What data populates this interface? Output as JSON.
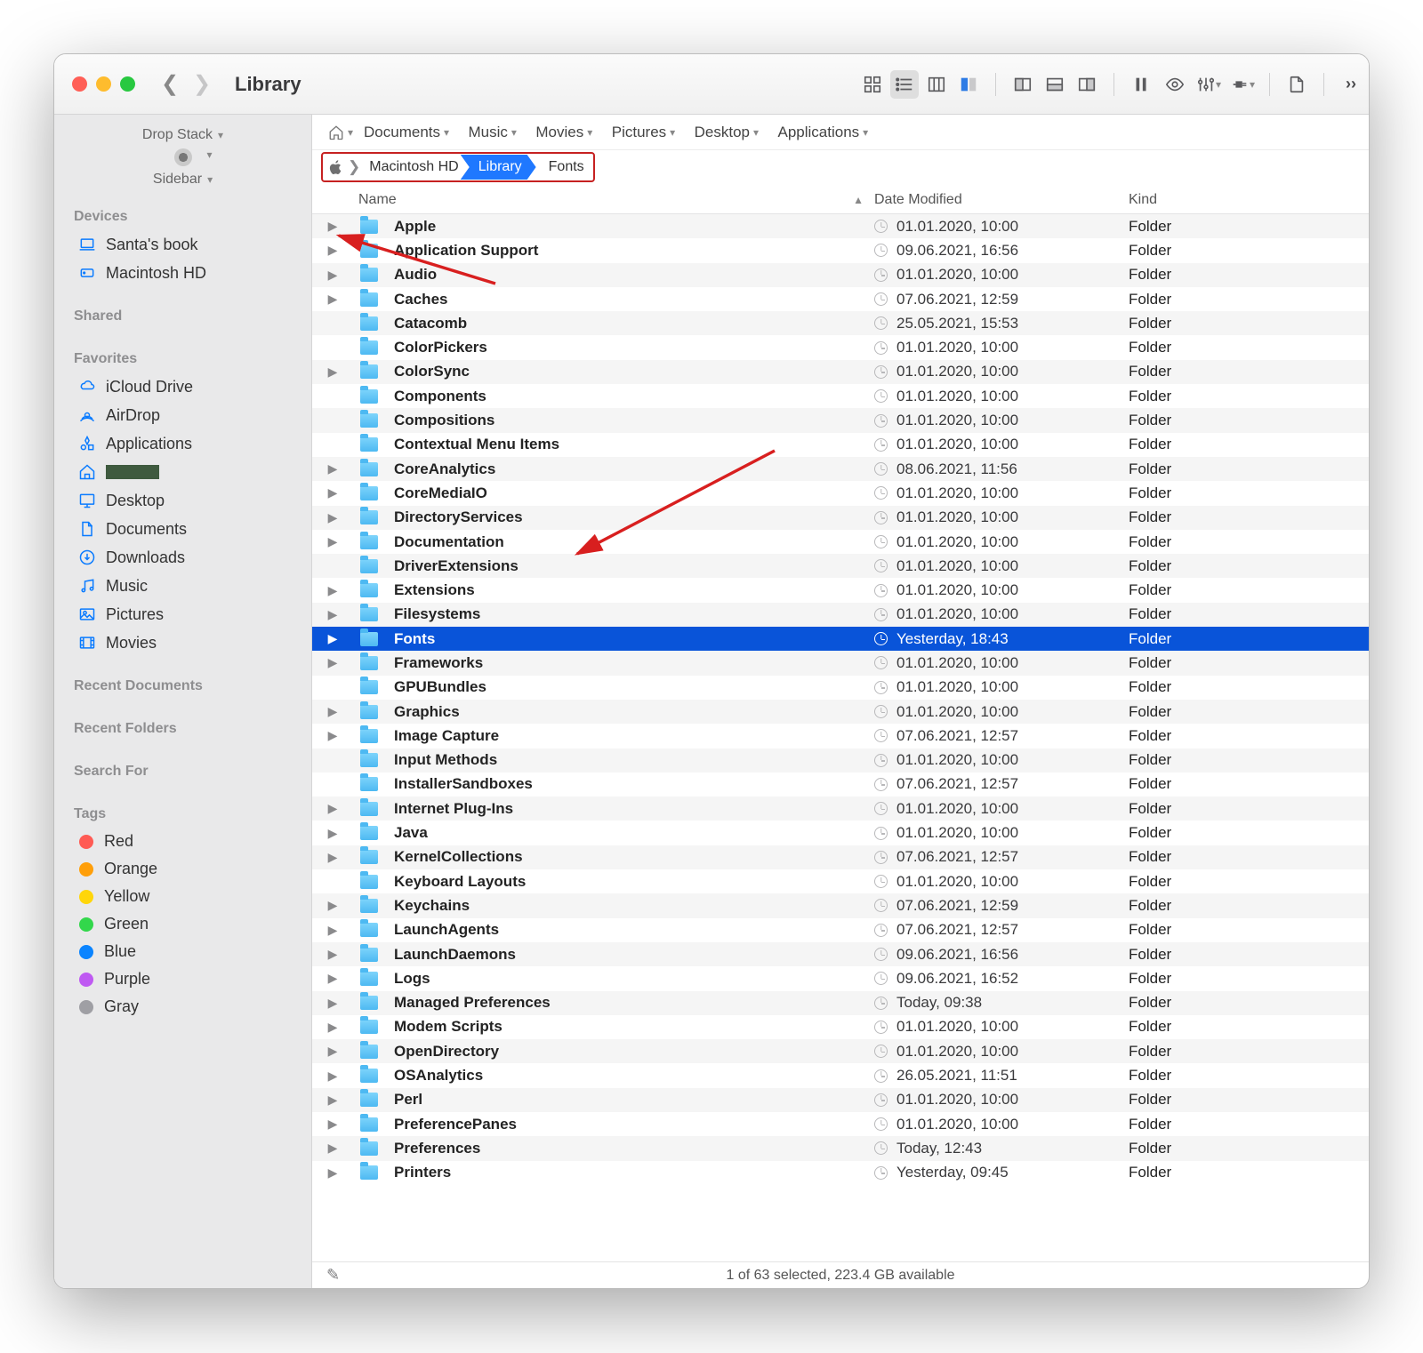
{
  "window": {
    "title": "Library"
  },
  "toolbar": {
    "view_modes": [
      "grid",
      "list",
      "columns",
      "gallery"
    ],
    "active_view": "list"
  },
  "sidebar": {
    "drop_stack": "Drop Stack",
    "sidebar_label": "Sidebar",
    "sections": {
      "devices": {
        "heading": "Devices",
        "items": [
          {
            "icon": "laptop",
            "label": "Santa's book"
          },
          {
            "icon": "disk",
            "label": "Macintosh HD"
          }
        ]
      },
      "shared": {
        "heading": "Shared"
      },
      "favorites": {
        "heading": "Favorites",
        "items": [
          {
            "icon": "cloud",
            "label": "iCloud Drive"
          },
          {
            "icon": "airdrop",
            "label": "AirDrop"
          },
          {
            "icon": "apps",
            "label": "Applications"
          },
          {
            "icon": "home",
            "label": "",
            "redacted": true
          },
          {
            "icon": "desktop",
            "label": "Desktop"
          },
          {
            "icon": "docs",
            "label": "Documents"
          },
          {
            "icon": "down",
            "label": "Downloads"
          },
          {
            "icon": "music",
            "label": "Music"
          },
          {
            "icon": "pics",
            "label": "Pictures"
          },
          {
            "icon": "movies",
            "label": "Movies"
          }
        ]
      },
      "recent_docs": {
        "heading": "Recent Documents"
      },
      "recent_folders": {
        "heading": "Recent Folders"
      },
      "search_for": {
        "heading": "Search For"
      },
      "tags": {
        "heading": "Tags",
        "items": [
          {
            "color": "#ff5b54",
            "label": "Red"
          },
          {
            "color": "#ff9f0a",
            "label": "Orange"
          },
          {
            "color": "#ffd60a",
            "label": "Yellow"
          },
          {
            "color": "#32d74b",
            "label": "Green"
          },
          {
            "color": "#0a84ff",
            "label": "Blue"
          },
          {
            "color": "#bf5af2",
            "label": "Purple"
          },
          {
            "color": "#9f9fa4",
            "label": "Gray"
          }
        ]
      }
    }
  },
  "linkbar": {
    "items": [
      "Documents",
      "Music",
      "Movies",
      "Pictures",
      "Desktop",
      "Applications"
    ]
  },
  "path": {
    "segments": [
      {
        "label": "Macintosh HD",
        "active": false
      },
      {
        "label": "Library",
        "active": true
      },
      {
        "label": "Fonts",
        "active": false
      }
    ]
  },
  "columns": {
    "name": "Name",
    "date": "Date Modified",
    "kind": "Kind"
  },
  "kind_folder": "Folder",
  "rows": [
    {
      "name": "Apple",
      "date": "01.01.2020, 10:00",
      "expand": true
    },
    {
      "name": "Application Support",
      "date": "09.06.2021, 16:56",
      "expand": true
    },
    {
      "name": "Audio",
      "date": "01.01.2020, 10:00",
      "expand": true
    },
    {
      "name": "Caches",
      "date": "07.06.2021, 12:59",
      "expand": true
    },
    {
      "name": "Catacomb",
      "date": "25.05.2021, 15:53",
      "expand": false
    },
    {
      "name": "ColorPickers",
      "date": "01.01.2020, 10:00",
      "expand": false
    },
    {
      "name": "ColorSync",
      "date": "01.01.2020, 10:00",
      "expand": true
    },
    {
      "name": "Components",
      "date": "01.01.2020, 10:00",
      "expand": false
    },
    {
      "name": "Compositions",
      "date": "01.01.2020, 10:00",
      "expand": false
    },
    {
      "name": "Contextual Menu Items",
      "date": "01.01.2020, 10:00",
      "expand": false
    },
    {
      "name": "CoreAnalytics",
      "date": "08.06.2021, 11:56",
      "expand": true
    },
    {
      "name": "CoreMediaIO",
      "date": "01.01.2020, 10:00",
      "expand": true
    },
    {
      "name": "DirectoryServices",
      "date": "01.01.2020, 10:00",
      "expand": true
    },
    {
      "name": "Documentation",
      "date": "01.01.2020, 10:00",
      "expand": true
    },
    {
      "name": "DriverExtensions",
      "date": "01.01.2020, 10:00",
      "expand": false
    },
    {
      "name": "Extensions",
      "date": "01.01.2020, 10:00",
      "expand": true
    },
    {
      "name": "Filesystems",
      "date": "01.01.2020, 10:00",
      "expand": true
    },
    {
      "name": "Fonts",
      "date": "Yesterday, 18:43",
      "expand": true,
      "selected": true
    },
    {
      "name": "Frameworks",
      "date": "01.01.2020, 10:00",
      "expand": true
    },
    {
      "name": "GPUBundles",
      "date": "01.01.2020, 10:00",
      "expand": false
    },
    {
      "name": "Graphics",
      "date": "01.01.2020, 10:00",
      "expand": true
    },
    {
      "name": "Image Capture",
      "date": "07.06.2021, 12:57",
      "expand": true
    },
    {
      "name": "Input Methods",
      "date": "01.01.2020, 10:00",
      "expand": false
    },
    {
      "name": "InstallerSandboxes",
      "date": "07.06.2021, 12:57",
      "expand": false
    },
    {
      "name": "Internet Plug-Ins",
      "date": "01.01.2020, 10:00",
      "expand": true
    },
    {
      "name": "Java",
      "date": "01.01.2020, 10:00",
      "expand": true
    },
    {
      "name": "KernelCollections",
      "date": "07.06.2021, 12:57",
      "expand": true
    },
    {
      "name": "Keyboard Layouts",
      "date": "01.01.2020, 10:00",
      "expand": false
    },
    {
      "name": "Keychains",
      "date": "07.06.2021, 12:59",
      "expand": true
    },
    {
      "name": "LaunchAgents",
      "date": "07.06.2021, 12:57",
      "expand": true
    },
    {
      "name": "LaunchDaemons",
      "date": "09.06.2021, 16:56",
      "expand": true
    },
    {
      "name": "Logs",
      "date": "09.06.2021, 16:52",
      "expand": true
    },
    {
      "name": "Managed Preferences",
      "date": "Today, 09:38",
      "expand": true
    },
    {
      "name": "Modem Scripts",
      "date": "01.01.2020, 10:00",
      "expand": true
    },
    {
      "name": "OpenDirectory",
      "date": "01.01.2020, 10:00",
      "expand": true
    },
    {
      "name": "OSAnalytics",
      "date": "26.05.2021, 11:51",
      "expand": true
    },
    {
      "name": "Perl",
      "date": "01.01.2020, 10:00",
      "expand": true
    },
    {
      "name": "PreferencePanes",
      "date": "01.01.2020, 10:00",
      "expand": true
    },
    {
      "name": "Preferences",
      "date": "Today, 12:43",
      "expand": true
    },
    {
      "name": "Printers",
      "date": "Yesterday, 09:45",
      "expand": true
    }
  ],
  "status": "1 of 63 selected, 223.4 GB available"
}
